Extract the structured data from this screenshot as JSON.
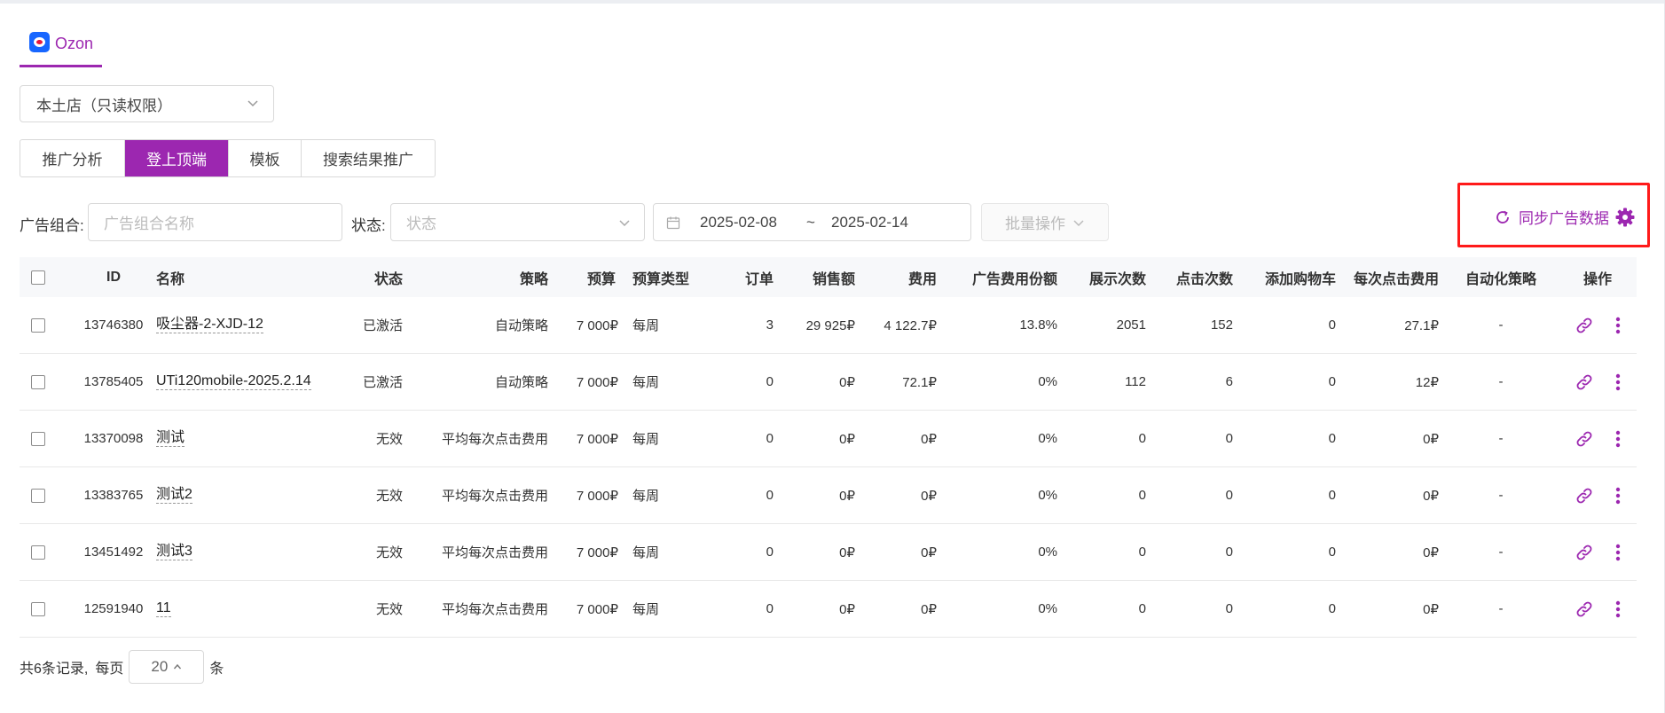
{
  "platform": {
    "label": "Ozon"
  },
  "store_select": {
    "value": "本土店（只读权限）"
  },
  "tabs": [
    {
      "label": "推广分析",
      "active": false
    },
    {
      "label": "登上顶端",
      "active": true
    },
    {
      "label": "模板",
      "active": false
    },
    {
      "label": "搜索结果推广",
      "active": false
    }
  ],
  "filters": {
    "group_label": "广告组合:",
    "group_placeholder": "广告组合名称",
    "status_label": "状态:",
    "status_placeholder": "状态",
    "date_start": "2025-02-08",
    "date_sep": "~",
    "date_end": "2025-02-14",
    "batch_label": "批量操作"
  },
  "sync": {
    "label": "同步广告数据"
  },
  "colors": {
    "accent": "#9c27b0",
    "highlight": "#ff1a1a"
  },
  "table": {
    "headers": {
      "id": "ID",
      "name": "名称",
      "status": "状态",
      "strategy": "策略",
      "budget": "预算",
      "budget_type": "预算类型",
      "orders": "订单",
      "sales": "销售额",
      "cost": "费用",
      "cost_share": "广告费用份额",
      "impressions": "展示次数",
      "clicks": "点击次数",
      "add_to_cart": "添加购物车",
      "cpc": "每次点击费用",
      "auto_strategy": "自动化策略",
      "actions": "操作"
    },
    "rows": [
      {
        "id": "13746380",
        "name": "吸尘器-2-XJD-12",
        "status": "已激活",
        "strategy": "自动策略",
        "budget": "7 000₽",
        "budget_type": "每周",
        "orders": "3",
        "sales": "29 925₽",
        "cost": "4 122.7₽",
        "cost_share": "13.8%",
        "impressions": "2051",
        "clicks": "152",
        "add_to_cart": "0",
        "cpc": "27.1₽",
        "auto_strategy": "-"
      },
      {
        "id": "13785405",
        "name": "UTi120mobile-2025.2.14",
        "status": "已激活",
        "strategy": "自动策略",
        "budget": "7 000₽",
        "budget_type": "每周",
        "orders": "0",
        "sales": "0₽",
        "cost": "72.1₽",
        "cost_share": "0%",
        "impressions": "112",
        "clicks": "6",
        "add_to_cart": "0",
        "cpc": "12₽",
        "auto_strategy": "-"
      },
      {
        "id": "13370098",
        "name": "测试",
        "status": "无效",
        "strategy": "平均每次点击费用",
        "budget": "7 000₽",
        "budget_type": "每周",
        "orders": "0",
        "sales": "0₽",
        "cost": "0₽",
        "cost_share": "0%",
        "impressions": "0",
        "clicks": "0",
        "add_to_cart": "0",
        "cpc": "0₽",
        "auto_strategy": "-"
      },
      {
        "id": "13383765",
        "name": "测试2",
        "status": "无效",
        "strategy": "平均每次点击费用",
        "budget": "7 000₽",
        "budget_type": "每周",
        "orders": "0",
        "sales": "0₽",
        "cost": "0₽",
        "cost_share": "0%",
        "impressions": "0",
        "clicks": "0",
        "add_to_cart": "0",
        "cpc": "0₽",
        "auto_strategy": "-"
      },
      {
        "id": "13451492",
        "name": "测试3",
        "status": "无效",
        "strategy": "平均每次点击费用",
        "budget": "7 000₽",
        "budget_type": "每周",
        "orders": "0",
        "sales": "0₽",
        "cost": "0₽",
        "cost_share": "0%",
        "impressions": "0",
        "clicks": "0",
        "add_to_cart": "0",
        "cpc": "0₽",
        "auto_strategy": "-"
      },
      {
        "id": "12591940",
        "name": "11",
        "status": "无效",
        "strategy": "平均每次点击费用",
        "budget": "7 000₽",
        "budget_type": "每周",
        "orders": "0",
        "sales": "0₽",
        "cost": "0₽",
        "cost_share": "0%",
        "impressions": "0",
        "clicks": "0",
        "add_to_cart": "0",
        "cpc": "0₽",
        "auto_strategy": "-"
      }
    ]
  },
  "footer": {
    "total_text": "共6条记录,",
    "per_page_label": "每页",
    "page_size": "20",
    "unit": "条"
  }
}
